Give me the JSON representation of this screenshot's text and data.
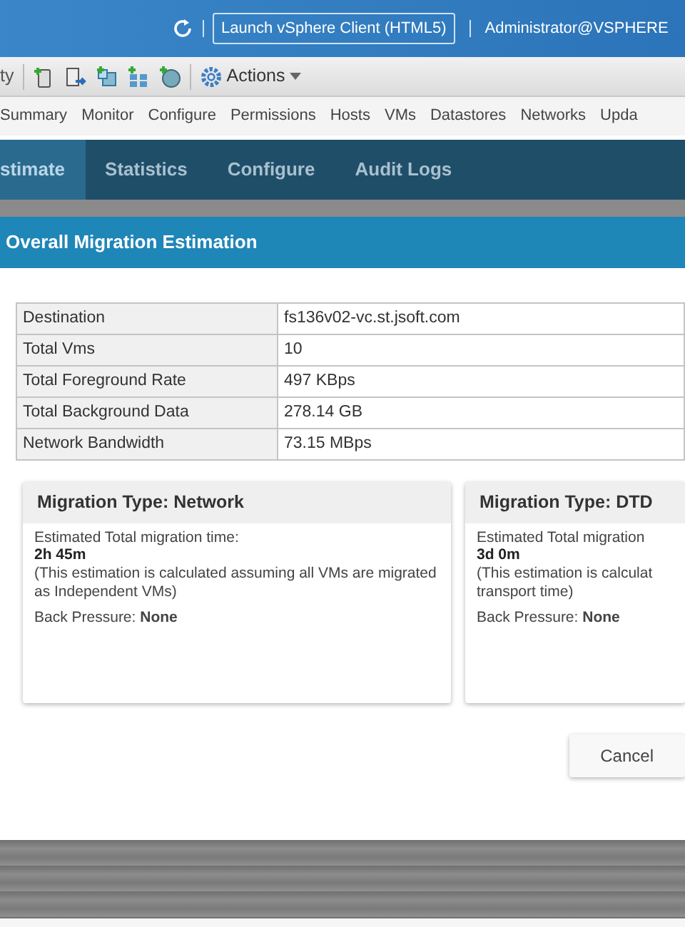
{
  "top_bar": {
    "launch_button": "Launch vSphere Client (HTML5)",
    "user": "Administrator@VSPHERE"
  },
  "toolbar": {
    "cut_label": "ty",
    "actions": "Actions"
  },
  "object_tabs": [
    {
      "label": "Summary",
      "selected": false
    },
    {
      "label": "Monitor",
      "selected": false
    },
    {
      "label": "Configure",
      "selected": false
    },
    {
      "label": "Permissions",
      "selected": false
    },
    {
      "label": "Hosts",
      "selected": false
    },
    {
      "label": "VMs",
      "selected": false
    },
    {
      "label": "Datastores",
      "selected": false
    },
    {
      "label": "Networks",
      "selected": false
    },
    {
      "label": "Upda",
      "selected": false
    }
  ],
  "plugin_tabs": [
    {
      "label": "stimate",
      "selected": true
    },
    {
      "label": "Statistics",
      "selected": false
    },
    {
      "label": "Configure",
      "selected": false
    },
    {
      "label": "Audit Logs",
      "selected": false
    }
  ],
  "dialog": {
    "title": "Overall Migration Estimation",
    "summary": [
      {
        "label": "Destination",
        "value": "fs136v02-vc.st.jsoft.com"
      },
      {
        "label": "Total Vms",
        "value": "10"
      },
      {
        "label": "Total Foreground Rate",
        "value": "497 KBps"
      },
      {
        "label": "Total Background Data",
        "value": "278.14 GB"
      },
      {
        "label": "Network Bandwidth",
        "value": "73.15 MBps"
      }
    ],
    "migration_types": [
      {
        "title": "Migration Type: Network",
        "time_label": "Estimated Total migration time:",
        "time": "2h 45m",
        "note": "(This estimation is calculated assuming all VMs are migrated as Independent VMs)",
        "back_pressure": "Back Pressure: **None**"
      },
      {
        "title": "Migration Type: DTD",
        "time_label": "Estimated Total migration",
        "time": "3d 0m",
        "note": "(This estimation is calculat transport time)",
        "back_pressure": "Back Pressure: **None**"
      }
    ],
    "cancel": "Cancel"
  }
}
